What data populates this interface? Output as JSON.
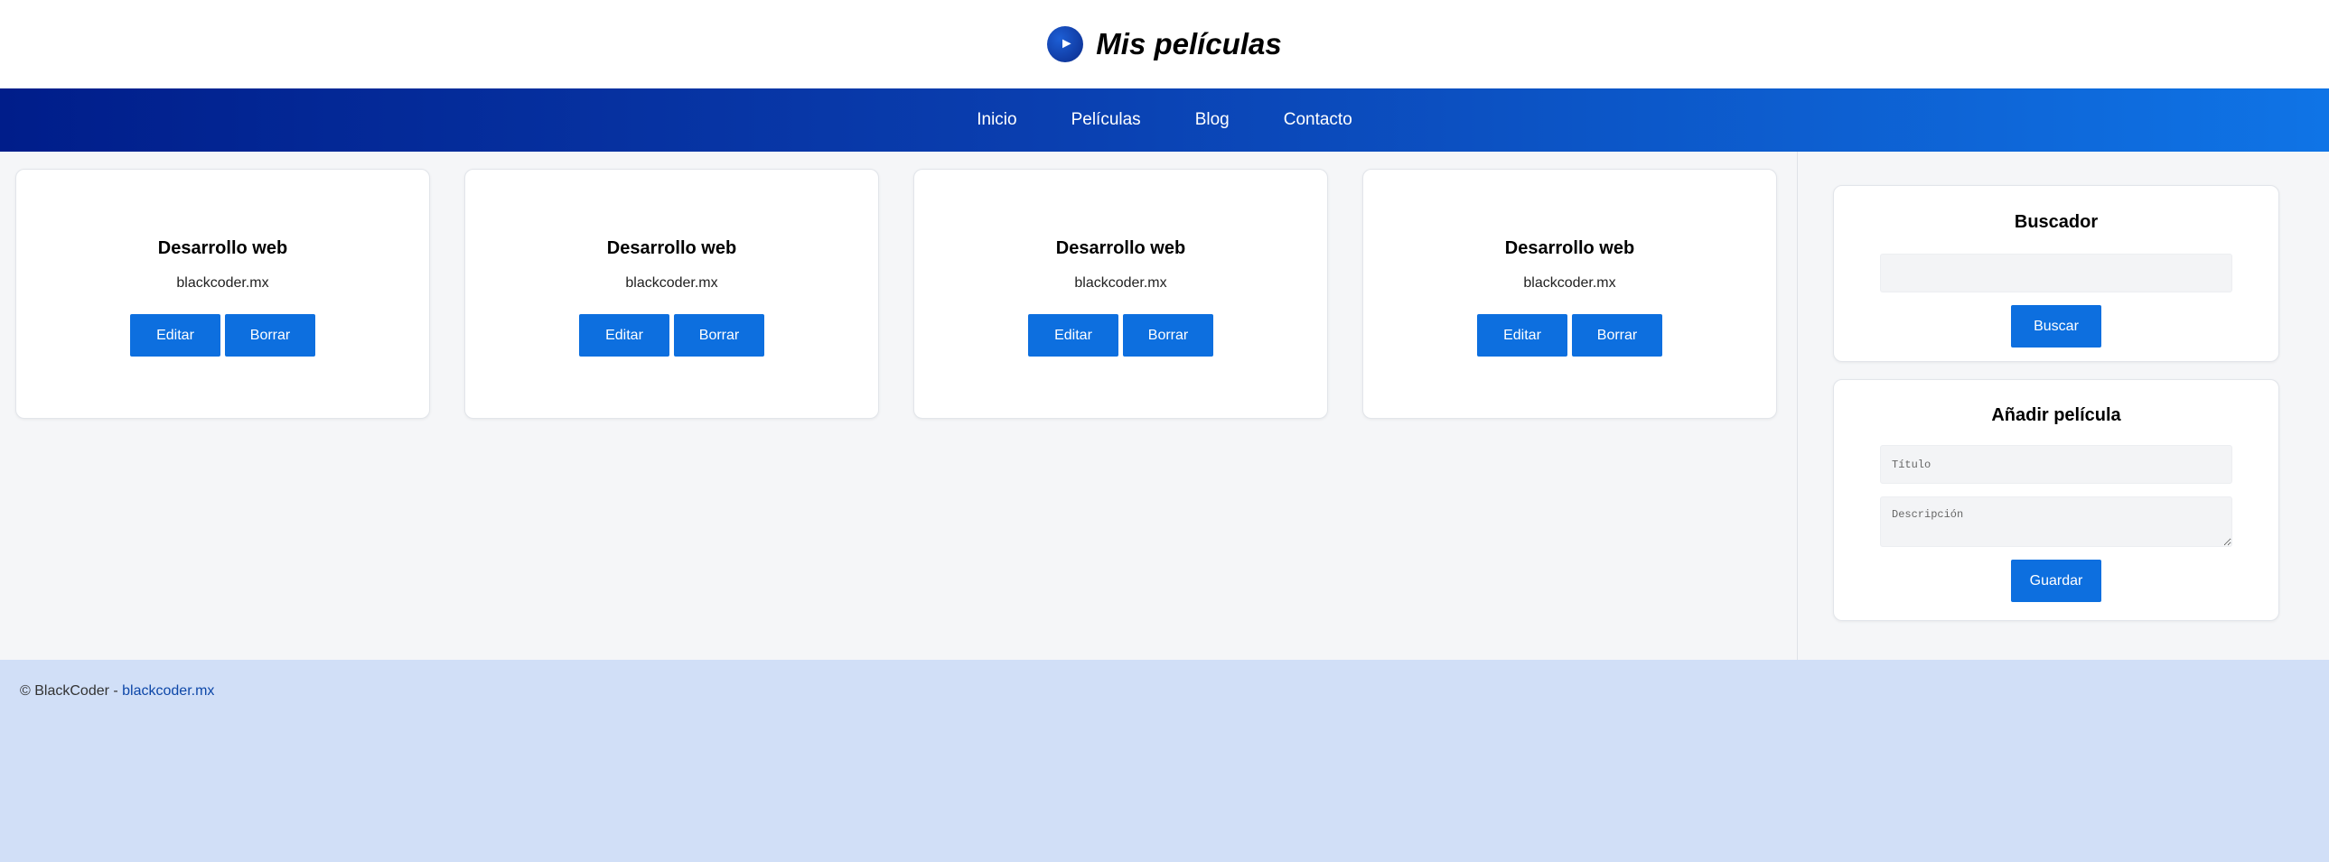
{
  "header": {
    "logo_icon": "play-icon",
    "logo_glyph": "►",
    "title": "Mis películas"
  },
  "nav": {
    "items": [
      {
        "label": "Inicio"
      },
      {
        "label": "Películas"
      },
      {
        "label": "Blog"
      },
      {
        "label": "Contacto"
      }
    ]
  },
  "movies": [
    {
      "title": "Desarrollo web",
      "description": "blackcoder.mx",
      "edit_label": "Editar",
      "delete_label": "Borrar"
    },
    {
      "title": "Desarrollo web",
      "description": "blackcoder.mx",
      "edit_label": "Editar",
      "delete_label": "Borrar"
    },
    {
      "title": "Desarrollo web",
      "description": "blackcoder.mx",
      "edit_label": "Editar",
      "delete_label": "Borrar"
    },
    {
      "title": "Desarrollo web",
      "description": "blackcoder.mx",
      "edit_label": "Editar",
      "delete_label": "Borrar"
    }
  ],
  "sidebar": {
    "search": {
      "title": "Buscador",
      "input_value": "",
      "button_label": "Buscar"
    },
    "add": {
      "title": "Añadir película",
      "title_placeholder": "Título",
      "description_placeholder": "Descripción",
      "button_label": "Guardar"
    }
  },
  "footer": {
    "text": "© BlackCoder - ",
    "link_text": "blackcoder.mx"
  },
  "colors": {
    "accent": "#0d6fdf",
    "nav_start": "#001d8a",
    "nav_end": "#0f74e6",
    "footer_bg": "#d1dff7"
  }
}
